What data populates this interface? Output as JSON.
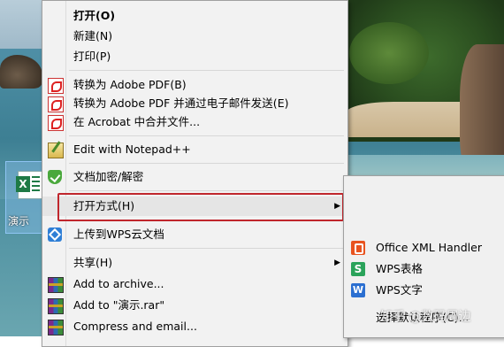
{
  "desktop": {
    "icon_label": "演示"
  },
  "context_menu": {
    "items": [
      {
        "label": "打开(O)"
      },
      {
        "label": "新建(N)"
      },
      {
        "label": "打印(P)"
      },
      {
        "label": "转换为 Adobe PDF(B)"
      },
      {
        "label": "转换为 Adobe PDF 并通过电子邮件发送(E)"
      },
      {
        "label": "在 Acrobat 中合并文件..."
      },
      {
        "label": "Edit with Notepad++"
      },
      {
        "label": "文档加密/解密"
      },
      {
        "label": "打开方式(H)"
      },
      {
        "label": "上传到WPS云文档"
      },
      {
        "label": "共享(H)"
      },
      {
        "label": "Add to archive..."
      },
      {
        "label": "Add to \"演示.rar\""
      },
      {
        "label": "Compress and email..."
      }
    ]
  },
  "open_with_submenu": {
    "items": [
      {
        "label": "Office XML Handler"
      },
      {
        "label": "WPS表格"
      },
      {
        "label": "WPS文字"
      },
      {
        "label": "选择默认程序(C)..."
      }
    ]
  },
  "watermark": "知乎 @数码周边",
  "colors": {
    "highlight_border": "#c0262d",
    "menu_bg": "#f2f2f2"
  }
}
